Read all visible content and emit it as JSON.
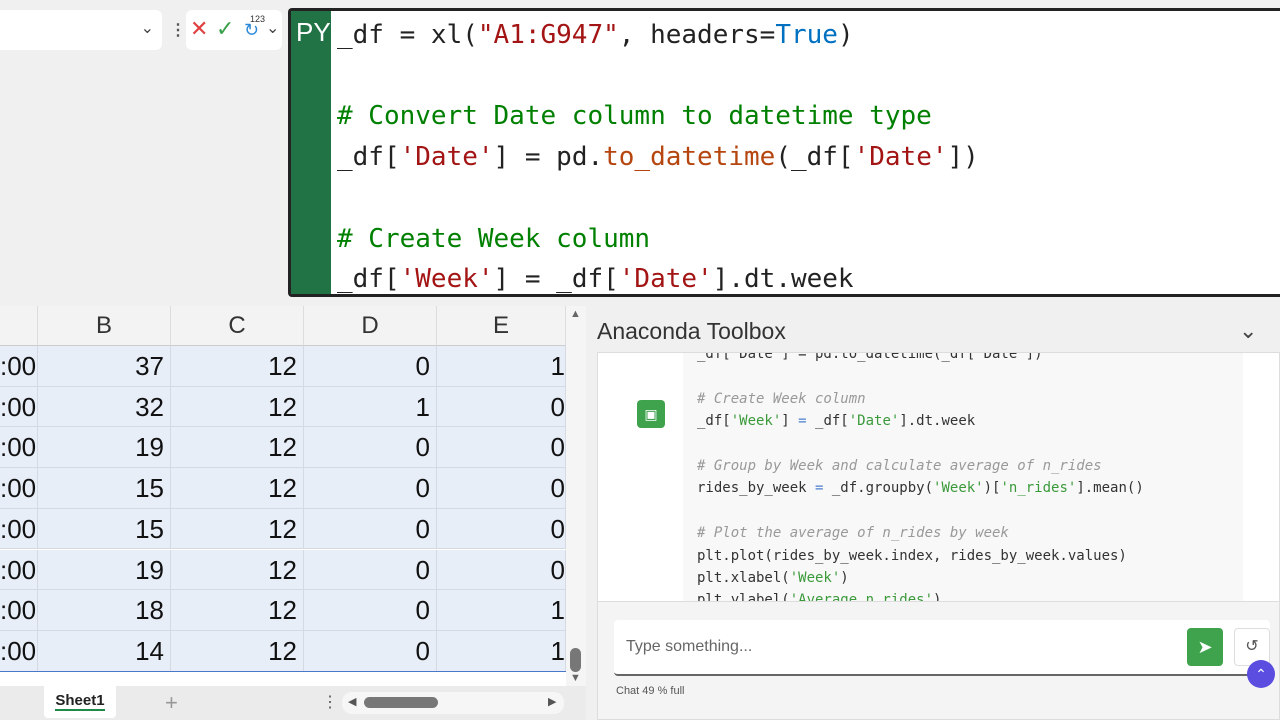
{
  "formula_bar": {
    "py_label": "PY",
    "superscript": "123"
  },
  "editor_lines": [
    [
      [
        "_df = xl(",
        ""
      ],
      [
        "\"A1:G947\"",
        "st"
      ],
      [
        ", headers=",
        ""
      ],
      [
        "True",
        "kw"
      ],
      [
        ")",
        ""
      ]
    ],
    [],
    [
      [
        "# Convert Date column to datetime type",
        "cm"
      ]
    ],
    [
      [
        "_df[",
        ""
      ],
      [
        "'Date'",
        "st"
      ],
      [
        "] = pd.",
        ""
      ],
      [
        "to_datetime",
        "fn"
      ],
      [
        "(_df[",
        ""
      ],
      [
        "'Date'",
        "st"
      ],
      [
        "])",
        ""
      ]
    ],
    [],
    [
      [
        "# Create Week column",
        "cm"
      ]
    ],
    [
      [
        "_df[",
        ""
      ],
      [
        "'Week'",
        "st"
      ],
      [
        "] = _df[",
        ""
      ],
      [
        "'Date'",
        "st"
      ],
      [
        "].dt.week",
        ""
      ]
    ]
  ],
  "grid": {
    "columns": [
      "B",
      "C",
      "D",
      "E"
    ],
    "rows": [
      [
        ":00",
        "37",
        "12",
        "0",
        "1"
      ],
      [
        ":00",
        "32",
        "12",
        "1",
        "0"
      ],
      [
        ":00",
        "19",
        "12",
        "0",
        "0"
      ],
      [
        ":00",
        "15",
        "12",
        "0",
        "0"
      ],
      [
        ":00",
        "15",
        "12",
        "0",
        "0"
      ],
      [
        ":00",
        "19",
        "12",
        "0",
        "0"
      ],
      [
        ":00",
        "18",
        "12",
        "0",
        "1"
      ],
      [
        ":00",
        "14",
        "12",
        "0",
        "1"
      ]
    ]
  },
  "sheet_tabs": {
    "active": "Sheet1",
    "add": "+"
  },
  "panel": {
    "title": "Anaconda Toolbox",
    "code_lines": [
      [
        [
          "_df['Date'] = pd.to_datetime(_df['Date'])",
          ""
        ]
      ],
      [],
      [
        [
          "# Create Week column",
          "c2"
        ]
      ],
      [
        [
          "_df[",
          ""
        ],
        [
          "'Week'",
          "s2"
        ],
        [
          "] ",
          ""
        ],
        [
          "=",
          "o2"
        ],
        [
          " _df[",
          ""
        ],
        [
          "'Date'",
          "s2"
        ],
        [
          "].dt.week",
          ""
        ]
      ],
      [],
      [
        [
          "# Group by Week and calculate average of n_rides",
          "c2"
        ]
      ],
      [
        [
          "rides_by_week ",
          ""
        ],
        [
          "=",
          "o2"
        ],
        [
          " _df.groupby(",
          ""
        ],
        [
          "'Week'",
          "s2"
        ],
        [
          ")[",
          ""
        ],
        [
          "'n_rides'",
          "s2"
        ],
        [
          "].mean()",
          ""
        ]
      ],
      [],
      [
        [
          "# Plot the average of n_rides by week",
          "c2"
        ]
      ],
      [
        [
          "plt.plot(rides_by_week.index, rides_by_week.values)",
          ""
        ]
      ],
      [
        [
          "plt.xlabel(",
          ""
        ],
        [
          "'Week'",
          "s2"
        ],
        [
          ")",
          ""
        ]
      ],
      [
        [
          "plt.ylabel(",
          ""
        ],
        [
          "'Average n_rides'",
          "s2"
        ],
        [
          ")",
          ""
        ]
      ]
    ],
    "input_placeholder": "Type something...",
    "status": "Chat 49 % full",
    "accent": "#3fa34d"
  }
}
